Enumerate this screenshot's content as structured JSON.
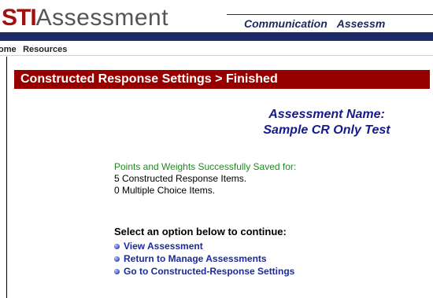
{
  "header": {
    "brand": "STI",
    "product": "Assessment",
    "top_nav": [
      "Communication",
      "Assessm"
    ]
  },
  "sub_nav": [
    "ome",
    "Resources"
  ],
  "page_title": "Constructed Response Settings > Finished",
  "assessment": {
    "label": "Assessment Name:",
    "value": "Sample CR Only Test"
  },
  "save_status": {
    "heading": "Points and Weights Successfully Saved for:",
    "constructed_items": "5 Constructed Response Items.",
    "multiple_choice_items": "0 Multiple Choice Items."
  },
  "options": {
    "prompt": "Select an option below to continue:",
    "links": [
      "View Assessment",
      "Return to Manage Assessments",
      "Go to Constructed-Response Settings"
    ]
  },
  "colors": {
    "title_bar": "#980000",
    "navy_bar": "#1c2a68",
    "success_text": "#1e8a1e",
    "assessment_name": "#141a8c",
    "link": "#1b2a9a"
  }
}
